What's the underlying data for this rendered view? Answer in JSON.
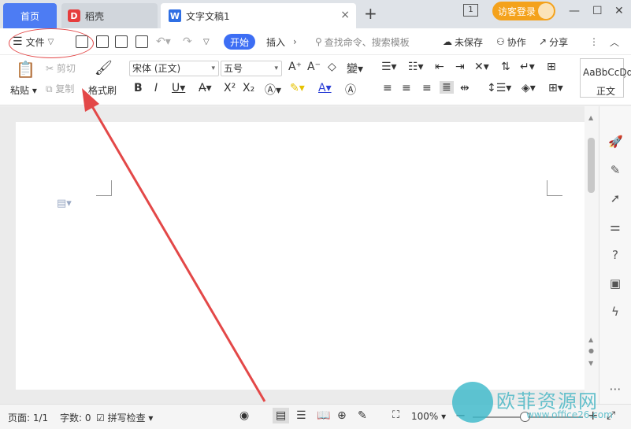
{
  "tabs": {
    "home": "首页",
    "daoke": "稻壳",
    "doc": "文字文稿1",
    "doc_close": "×",
    "add": "+"
  },
  "titlebar": {
    "badge": "1",
    "login": "访客登录",
    "minimize": "—",
    "maximize": "☐",
    "close": "✕"
  },
  "menu": {
    "file": "文件",
    "start": "开始",
    "insert": "插入",
    "search_placeholder": "查找命令、搜索模板",
    "unsaved": "未保存",
    "collab": "协作",
    "share": "分享"
  },
  "clipboard": {
    "paste": "粘贴",
    "cut": "剪切",
    "copy": "复制",
    "format_painter": "格式刷"
  },
  "font": {
    "family": "宋体 (正文)",
    "size": "五号"
  },
  "styles": {
    "preview": "AaBbCcDd",
    "normal": "正文"
  },
  "statusbar": {
    "page": "页面: 1/1",
    "words": "字数: 0",
    "spell": "拼写检查",
    "zoom": "100%"
  },
  "watermark": {
    "brand": "欧菲资源网",
    "url": "www.office26.com"
  },
  "colors": {
    "accent": "#3d6ef4",
    "home_tab": "#4d7cf3",
    "login": "#f4a21c",
    "annotation": "#e34848"
  }
}
